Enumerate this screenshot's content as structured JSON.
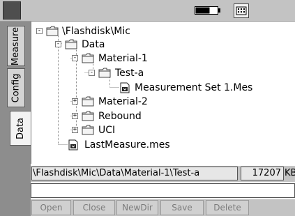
{
  "topbar": {
    "logo_icon": "moon-logo-icon",
    "battery_icon": "battery-icon",
    "keyboard_icon": "keyboard-icon"
  },
  "tabs": [
    {
      "label": "Measure",
      "active": false
    },
    {
      "label": "Config",
      "active": false
    },
    {
      "label": "Data",
      "active": true
    }
  ],
  "tree": [
    {
      "label": "\\Flashdisk\\Mic",
      "icon": "folder-icon",
      "expander": "-"
    },
    {
      "label": "Data",
      "icon": "folder-icon",
      "expander": "-"
    },
    {
      "label": "Material-1",
      "icon": "folder-icon",
      "expander": "-"
    },
    {
      "label": "Test-a",
      "icon": "folder-icon",
      "expander": "-"
    },
    {
      "label": "Measurement Set 1.Mes",
      "icon": "measurement-file-icon",
      "expander": ""
    },
    {
      "label": "Material-2",
      "icon": "folder-icon",
      "expander": "+"
    },
    {
      "label": "Rebound",
      "icon": "folder-icon",
      "expander": "+"
    },
    {
      "label": "UCI",
      "icon": "folder-icon",
      "expander": "+"
    },
    {
      "label": "LastMeasure.mes",
      "icon": "measurement-file-icon",
      "expander": ""
    }
  ],
  "path": {
    "current": "\\Flashdisk\\Mic\\Data\\Material-1\\Test-a",
    "free_size": "17207",
    "size_unit": "KB"
  },
  "name_input": {
    "value": ""
  },
  "buttons": [
    {
      "label": "Open"
    },
    {
      "label": "Close"
    },
    {
      "label": "NewDir"
    },
    {
      "label": "Save"
    },
    {
      "label": "Delete"
    }
  ]
}
